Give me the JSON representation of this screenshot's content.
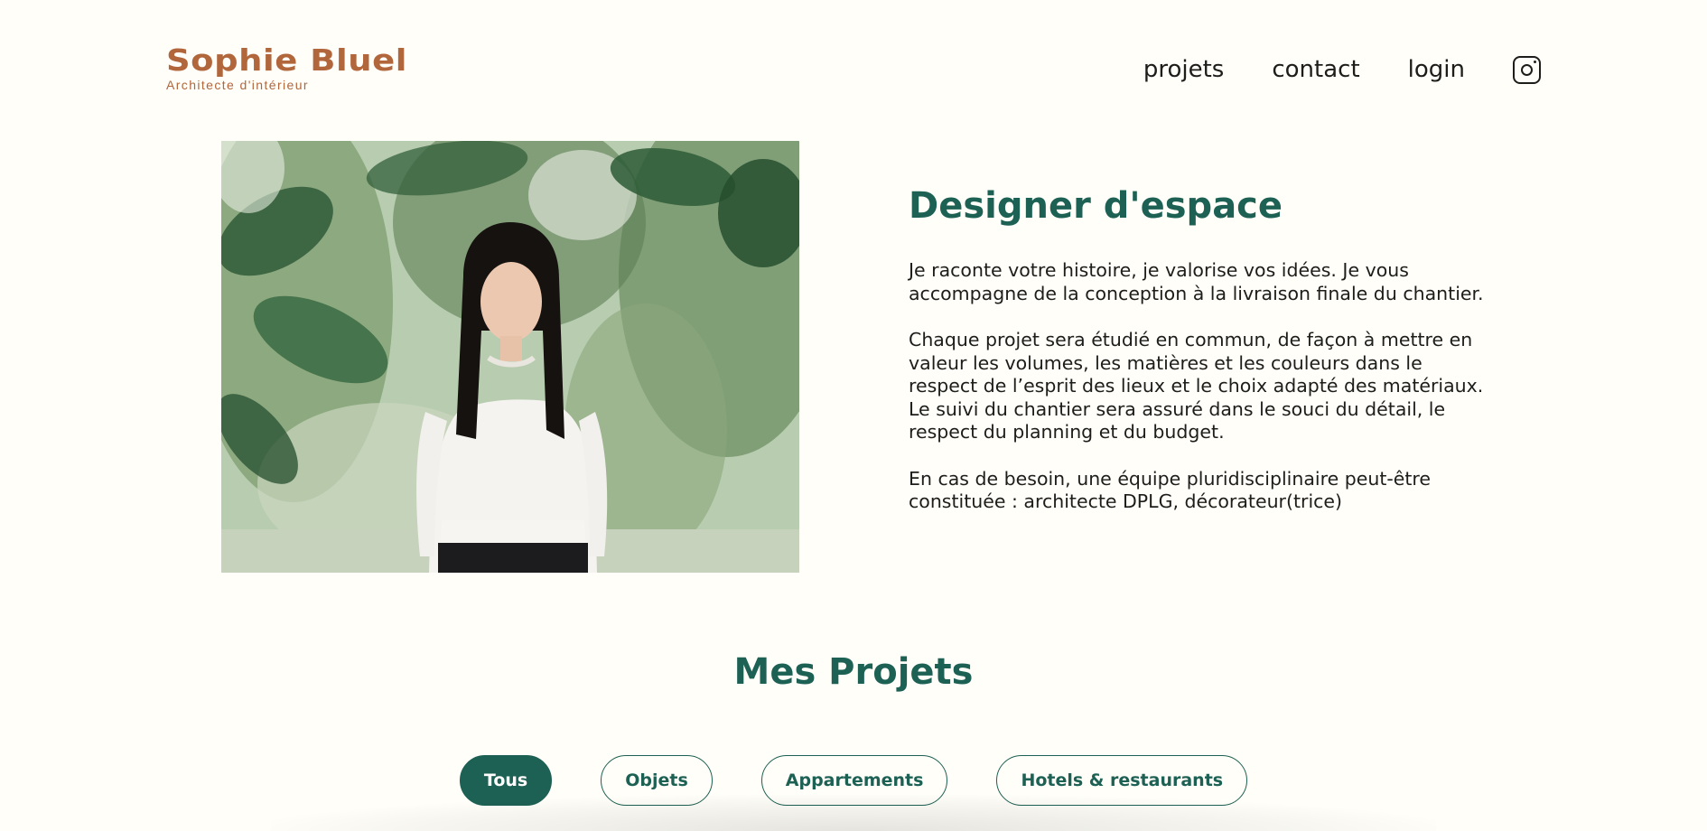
{
  "brand": {
    "name": "Sophie Bluel",
    "tagline": "Architecte d'intérieur",
    "color": "#B1663C"
  },
  "nav": {
    "items": [
      {
        "label": "projets"
      },
      {
        "label": "contact"
      },
      {
        "label": "login"
      }
    ],
    "social_icon": "instagram-icon"
  },
  "intro": {
    "title": "Designer d'espace",
    "paragraphs": [
      "Je raconte votre histoire, je valorise vos idées. Je vous accompagne de la conception à la livraison finale du chantier.",
      "Chaque projet sera étudié en commun, de façon à mettre en valeur les volumes, les matières et les couleurs dans le respect de l’esprit des lieux et le choix adapté des matériaux. Le suivi du chantier sera assuré dans le souci du détail, le respect du planning et du budget.",
      "En cas de besoin, une équipe pluridisciplinaire peut-être constituée : architecte DPLG, décorateur(trice)"
    ]
  },
  "projects": {
    "title": "Mes Projets",
    "filters": [
      {
        "label": "Tous",
        "active": true
      },
      {
        "label": "Objets",
        "active": false
      },
      {
        "label": "Appartements",
        "active": false
      },
      {
        "label": "Hotels & restaurants",
        "active": false
      }
    ]
  },
  "theme": {
    "accent": "#1D6154",
    "background": "#FFFEF8",
    "text": "#1D1D1B"
  }
}
